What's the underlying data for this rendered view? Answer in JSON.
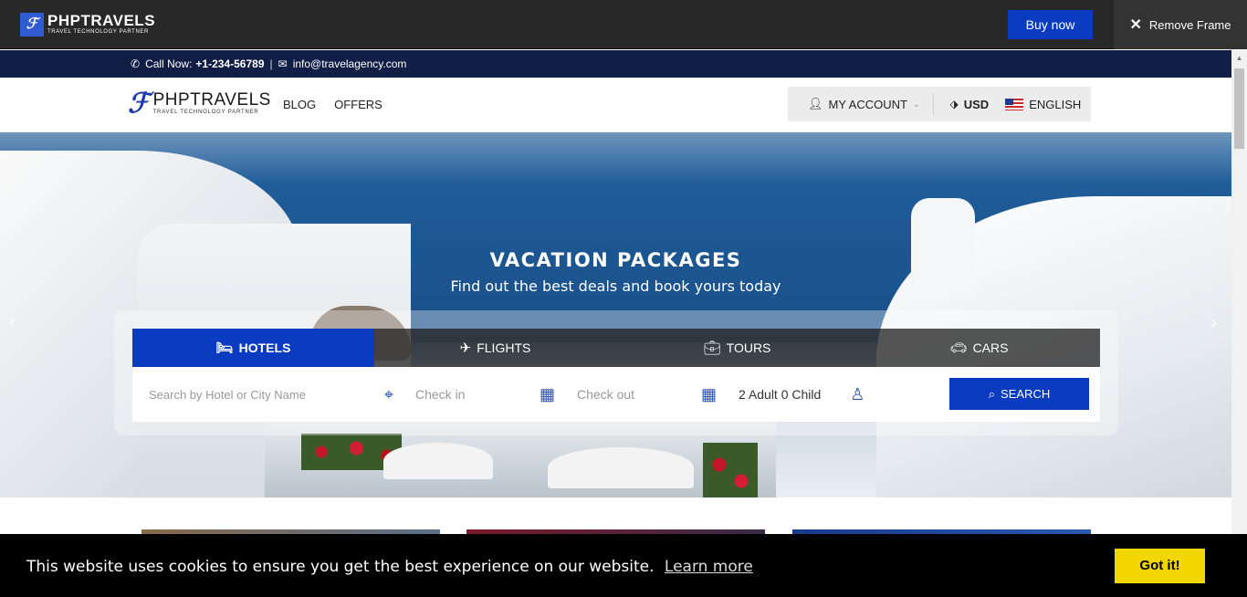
{
  "frame": {
    "brand_name": "PHPTRAVELS",
    "brand_tagline": "TRAVEL TECHNOLOGY PARTNER",
    "buy_now": "Buy now",
    "remove_frame": "Remove Frame"
  },
  "topbar": {
    "call_label": "Call Now:",
    "phone": "+1-234-56789",
    "separator": "|",
    "email": "info@travelagency.com"
  },
  "navbar": {
    "brand_name": "PHPTRAVELS",
    "brand_tagline": "TRAVEL TECHNOLOGY PARTNER",
    "links": [
      "BLOG",
      "OFFERS"
    ],
    "my_account": "MY ACCOUNT",
    "currency": "USD",
    "language": "ENGLISH"
  },
  "hero": {
    "title": "VACATION PACKAGES",
    "subtitle": "Find out the best deals and book yours today"
  },
  "search": {
    "tabs": [
      "HOTELS",
      "FLIGHTS",
      "TOURS",
      "CARS"
    ],
    "active_tab": "HOTELS",
    "city_placeholder": "Search by Hotel or City Name",
    "check_in": "Check in",
    "check_out": "Check out",
    "guests": "2 Adult 0 Child",
    "search_button": "SEARCH"
  },
  "cookie": {
    "message": "This website uses cookies to ensure you get the best experience on our website.",
    "learn_more": "Learn more",
    "got_it": "Got it!"
  },
  "colors": {
    "primary": "#0a3bc1",
    "topbar": "#111e45",
    "cookie_button": "#f1d600"
  }
}
